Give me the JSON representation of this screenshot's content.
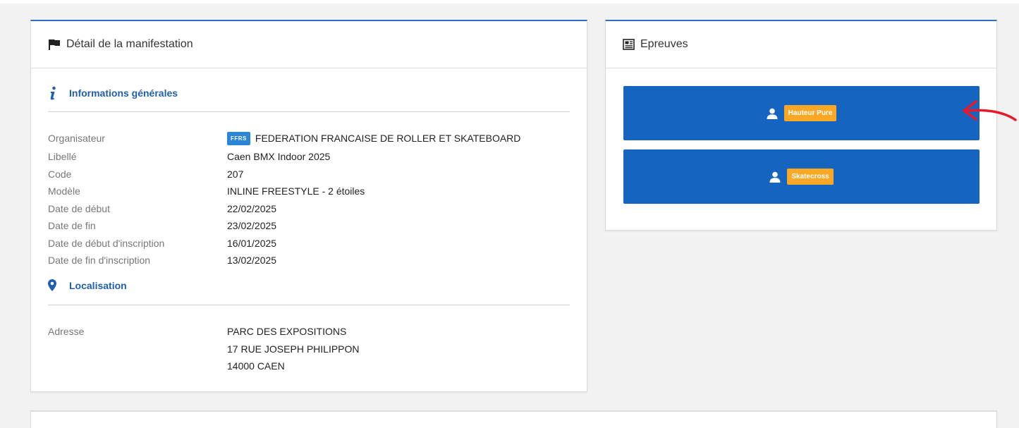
{
  "detail": {
    "title": "Détail de la manifestation",
    "general_title": "Informations générales",
    "fields": [
      {
        "label": "Organisateur",
        "value": "FEDERATION FRANCAISE DE ROLLER ET SKATEBOARD",
        "badge": "FFRS"
      },
      {
        "label": "Libellé",
        "value": "Caen BMX Indoor 2025"
      },
      {
        "label": "Code",
        "value": "207"
      },
      {
        "label": "Modèle",
        "value": "INLINE FREESTYLE - 2 étoiles"
      },
      {
        "label": "Date de début",
        "value": "22/02/2025"
      },
      {
        "label": "Date de fin",
        "value": "23/02/2025"
      },
      {
        "label": "Date de début d'inscription",
        "value": "16/01/2025"
      },
      {
        "label": "Date de fin d'inscription",
        "value": "13/02/2025"
      }
    ],
    "location_title": "Localisation",
    "address_label": "Adresse",
    "address_lines": [
      "PARC DES EXPOSITIONS",
      "17 RUE JOSEPH PHILIPPON",
      "14000 CAEN"
    ]
  },
  "epreuves": {
    "title": "Epreuves",
    "items": [
      {
        "label": "Hauteur Pure",
        "icon": "user-icon"
      },
      {
        "label": "Skatecross",
        "icon": "user-icon"
      }
    ]
  },
  "colors": {
    "accent": "#1565c0",
    "tag": "#f9a825",
    "badge": "#2b86d9",
    "section_title": "#1f5fad",
    "annotation_arrow": "#e8192c"
  }
}
